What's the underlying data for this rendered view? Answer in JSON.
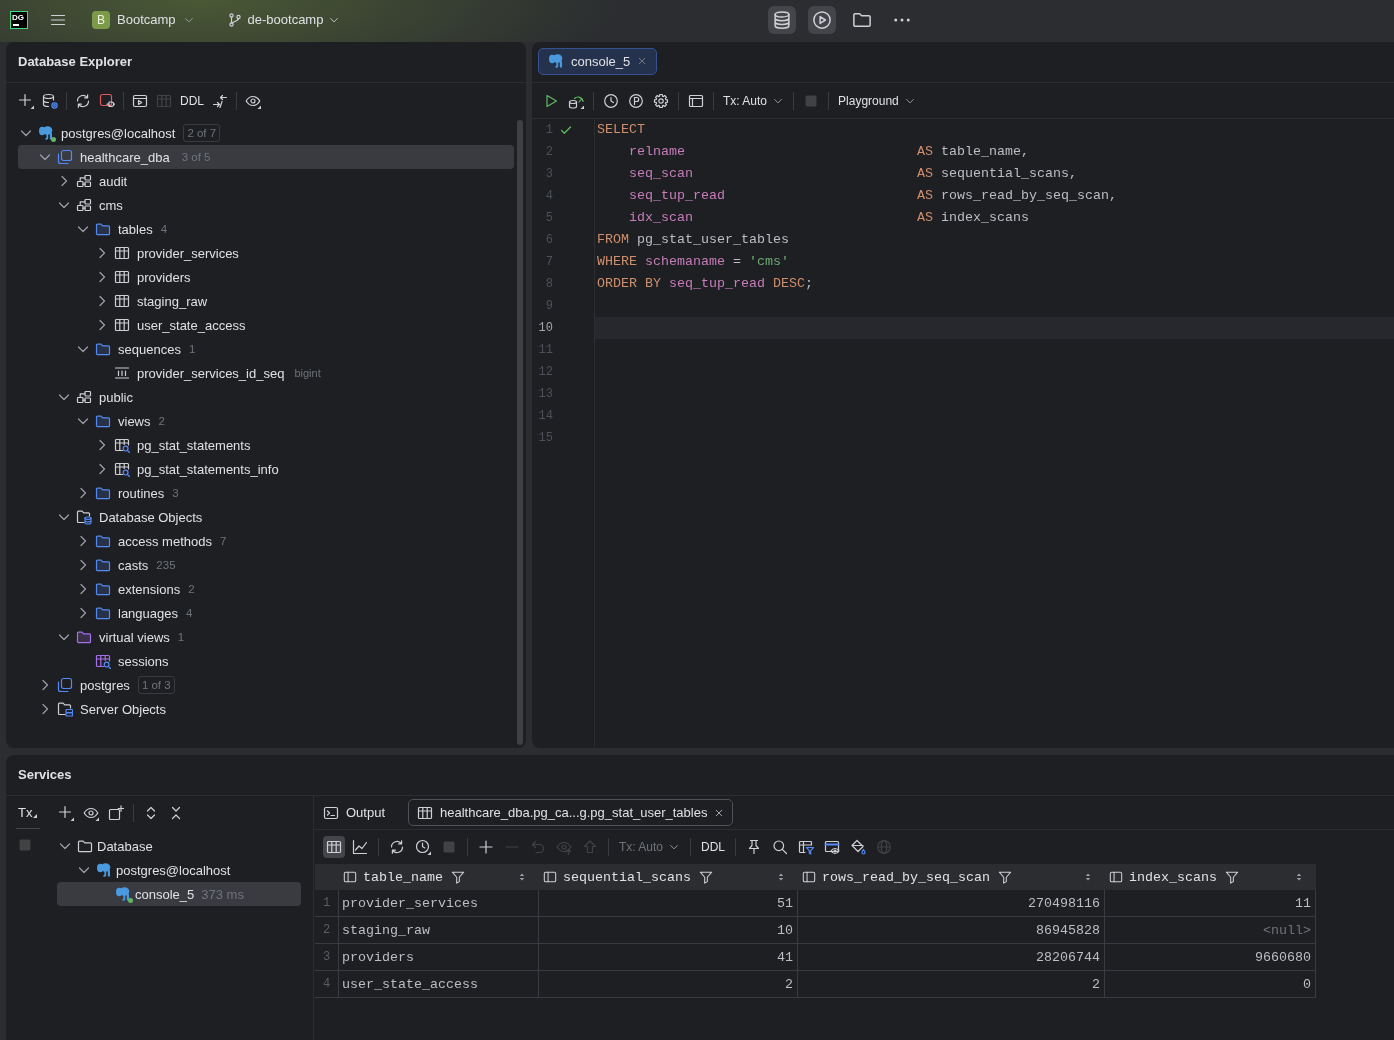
{
  "title_bar": {
    "logo": "DG",
    "project": {
      "initial": "B",
      "name": "Bootcamp"
    },
    "branch": "de-bootcamp",
    "tools": [
      {
        "kind": "database",
        "selected": true
      },
      {
        "kind": "services",
        "selected": true
      },
      {
        "kind": "project",
        "selected": false
      },
      {
        "kind": "more",
        "selected": false
      }
    ]
  },
  "database_explorer": {
    "title": "Database Explorer",
    "toolbar": [
      [
        {
          "kind": "add_menu",
          "disabled": false
        },
        {
          "kind": "data_source",
          "disabled": false
        }
      ],
      [
        {
          "kind": "refresh",
          "disabled": false
        },
        {
          "kind": "disconnect",
          "disabled": false
        }
      ],
      [
        {
          "kind": "console",
          "disabled": false
        },
        {
          "kind": "table",
          "disabled": true
        },
        {
          "kind": "ddl",
          "label": "DDL",
          "disabled": false
        },
        {
          "kind": "jump",
          "disabled": false
        }
      ],
      [
        {
          "kind": "view_options",
          "disabled": false
        }
      ]
    ],
    "tree": [
      {
        "kind": "connection",
        "label": "postgres@localhost",
        "badge": "2 of 7",
        "expanded": true,
        "selected": false,
        "connected": true,
        "children": [
          {
            "kind": "database",
            "label": "healthcare_dba",
            "badge": "3 of 5",
            "expanded": true,
            "selected": true,
            "children": [
              {
                "kind": "schema",
                "label": "audit",
                "expanded": false,
                "selected": false
              },
              {
                "kind": "schema",
                "label": "cms",
                "expanded": true,
                "selected": false,
                "children": [
                  {
                    "kind": "folder",
                    "label": "tables",
                    "count": "4",
                    "expanded": true,
                    "selected": false,
                    "children": [
                      {
                        "kind": "table",
                        "label": "provider_services",
                        "expanded": false,
                        "selected": false
                      },
                      {
                        "kind": "table",
                        "label": "providers",
                        "expanded": false,
                        "selected": false
                      },
                      {
                        "kind": "table",
                        "label": "staging_raw",
                        "expanded": false,
                        "selected": false
                      },
                      {
                        "kind": "table",
                        "label": "user_state_access",
                        "expanded": false,
                        "selected": false
                      }
                    ]
                  },
                  {
                    "kind": "folder",
                    "label": "sequences",
                    "count": "1",
                    "expanded": true,
                    "selected": false,
                    "children": [
                      {
                        "kind": "sequence",
                        "label": "provider_services_id_seq",
                        "detail": "bigint",
                        "selected": false
                      }
                    ]
                  }
                ]
              },
              {
                "kind": "schema",
                "label": "public",
                "expanded": true,
                "selected": false,
                "children": [
                  {
                    "kind": "folder",
                    "label": "views",
                    "count": "2",
                    "expanded": true,
                    "selected": false,
                    "children": [
                      {
                        "kind": "view",
                        "label": "pg_stat_statements",
                        "expanded": false,
                        "selected": false
                      },
                      {
                        "kind": "view",
                        "label": "pg_stat_statements_info",
                        "expanded": false,
                        "selected": false
                      }
                    ]
                  },
                  {
                    "kind": "folder",
                    "label": "routines",
                    "count": "3",
                    "expanded": false,
                    "selected": false
                  }
                ]
              },
              {
                "kind": "objects_folder",
                "label": "Database Objects",
                "expanded": true,
                "selected": false,
                "children": [
                  {
                    "kind": "folder",
                    "label": "access methods",
                    "count": "7",
                    "expanded": false,
                    "selected": false
                  },
                  {
                    "kind": "folder",
                    "label": "casts",
                    "count": "235",
                    "expanded": false,
                    "selected": false
                  },
                  {
                    "kind": "folder",
                    "label": "extensions",
                    "count": "2",
                    "expanded": false,
                    "selected": false
                  },
                  {
                    "kind": "folder",
                    "label": "languages",
                    "count": "4",
                    "expanded": false,
                    "selected": false
                  }
                ]
              },
              {
                "kind": "virtual_folder",
                "label": "virtual views",
                "count": "1",
                "expanded": true,
                "selected": false,
                "children": [
                  {
                    "kind": "virtual_view",
                    "label": "sessions",
                    "selected": false
                  }
                ]
              }
            ]
          },
          {
            "kind": "database",
            "label": "postgres",
            "badge": "1 of 3",
            "expanded": false,
            "selected": false
          },
          {
            "kind": "server_folder",
            "label": "Server Objects",
            "expanded": false,
            "selected": false
          }
        ]
      }
    ]
  },
  "editor": {
    "tabs": [
      {
        "label": "console_5",
        "selected": true
      }
    ],
    "toolbar": [
      [
        {
          "kind": "run",
          "disabled": false
        },
        {
          "kind": "run_config",
          "disabled": false
        }
      ],
      [
        {
          "kind": "history",
          "disabled": false
        },
        {
          "kind": "parameters",
          "disabled": false
        },
        {
          "kind": "settings",
          "disabled": false
        }
      ],
      [
        {
          "kind": "layout",
          "disabled": false
        }
      ],
      [
        {
          "kind": "tx_mode",
          "label": "Tx: Auto",
          "disabled": false
        }
      ],
      [
        {
          "kind": "stop",
          "disabled": true
        }
      ],
      [
        {
          "kind": "session_mode",
          "label": "Playground",
          "disabled": false
        }
      ]
    ],
    "lines": [
      {
        "number": "1",
        "executed": true,
        "current": false,
        "tokens": [
          {
            "text": "SELECT",
            "kind": "keyword"
          }
        ]
      },
      {
        "number": "2",
        "executed": false,
        "current": false,
        "tokens": [
          {
            "text": "    relname",
            "kind": "identifier"
          },
          {
            "text": "                             AS",
            "kind": "keyword"
          },
          {
            "text": " table_name,",
            "kind": "plain"
          }
        ]
      },
      {
        "number": "3",
        "executed": false,
        "current": false,
        "tokens": [
          {
            "text": "    seq_scan",
            "kind": "identifier"
          },
          {
            "text": "                            AS",
            "kind": "keyword"
          },
          {
            "text": " sequential_scans,",
            "kind": "plain"
          }
        ]
      },
      {
        "number": "4",
        "executed": false,
        "current": false,
        "tokens": [
          {
            "text": "    seq_tup_read",
            "kind": "identifier"
          },
          {
            "text": "                        AS",
            "kind": "keyword"
          },
          {
            "text": " rows_read_by_seq_scan,",
            "kind": "plain"
          }
        ]
      },
      {
        "number": "5",
        "executed": false,
        "current": false,
        "tokens": [
          {
            "text": "    idx_scan",
            "kind": "identifier"
          },
          {
            "text": "                            AS",
            "kind": "keyword"
          },
          {
            "text": " index_scans",
            "kind": "plain"
          }
        ]
      },
      {
        "number": "6",
        "executed": false,
        "current": false,
        "tokens": [
          {
            "text": "FROM",
            "kind": "keyword"
          },
          {
            "text": " pg_stat_user_tables",
            "kind": "plain"
          }
        ]
      },
      {
        "number": "7",
        "executed": false,
        "current": false,
        "tokens": [
          {
            "text": "WHERE",
            "kind": "keyword"
          },
          {
            "text": " schemaname",
            "kind": "identifier"
          },
          {
            "text": " = ",
            "kind": "plain"
          },
          {
            "text": "'cms'",
            "kind": "string"
          }
        ]
      },
      {
        "number": "8",
        "executed": false,
        "current": false,
        "tokens": [
          {
            "text": "ORDER BY",
            "kind": "keyword"
          },
          {
            "text": " seq_tup_read",
            "kind": "identifier"
          },
          {
            "text": " DESC",
            "kind": "keyword"
          },
          {
            "text": ";",
            "kind": "plain"
          }
        ]
      },
      {
        "number": "9",
        "executed": false,
        "current": false
      },
      {
        "number": "10",
        "executed": false,
        "current": true
      },
      {
        "number": "11",
        "executed": false,
        "current": false
      },
      {
        "number": "12",
        "executed": false,
        "current": false
      },
      {
        "number": "13",
        "executed": false,
        "current": false
      },
      {
        "number": "14",
        "executed": false,
        "current": false
      },
      {
        "number": "15",
        "executed": false,
        "current": false
      }
    ]
  },
  "services": {
    "title": "Services",
    "tx_column": {
      "label": "Tx",
      "items": [
        {
          "kind": "stop",
          "disabled": true
        }
      ]
    },
    "toolbar": [
      [
        {
          "kind": "add_menu",
          "disabled": false
        },
        {
          "kind": "view_options",
          "disabled": false
        },
        {
          "kind": "add_tab",
          "disabled": false
        }
      ],
      [
        {
          "kind": "expand",
          "disabled": false
        },
        {
          "kind": "collapse",
          "disabled": false
        }
      ]
    ],
    "tree": [
      {
        "kind": "plain_folder",
        "label": "Database",
        "expanded": true,
        "selected": false,
        "children": [
          {
            "kind": "connection",
            "label": "postgres@localhost",
            "expanded": true,
            "selected": false,
            "connected": false,
            "children": [
              {
                "kind": "connection",
                "label": "console_5",
                "detail": "373 ms",
                "selected": true,
                "connected": true
              }
            ]
          }
        ]
      }
    ],
    "tabs": [
      {
        "kind": "output",
        "label": "Output",
        "selected": false
      },
      {
        "kind": "result",
        "label": "healthcare_dba.pg_ca...g.pg_stat_user_tables",
        "selected": true
      }
    ],
    "result_toolbar": [
      [
        {
          "kind": "grid",
          "selected": true,
          "disabled": false
        },
        {
          "kind": "chart",
          "selected": false,
          "disabled": false
        }
      ],
      [
        {
          "kind": "refresh",
          "disabled": false
        },
        {
          "kind": "history_menu",
          "disabled": false
        },
        {
          "kind": "stop",
          "disabled": true
        }
      ],
      [
        {
          "kind": "add",
          "disabled": false
        },
        {
          "kind": "remove",
          "disabled": true
        },
        {
          "kind": "undo",
          "disabled": true
        },
        {
          "kind": "preview",
          "disabled": true
        },
        {
          "kind": "submit",
          "disabled": true
        }
      ],
      [
        {
          "kind": "tx_mode",
          "label": "Tx: Auto",
          "disabled": true
        }
      ],
      [
        {
          "kind": "ddl",
          "label": "DDL",
          "disabled": false
        }
      ],
      [
        {
          "kind": "pin",
          "disabled": false
        },
        {
          "kind": "search",
          "disabled": false
        },
        {
          "kind": "filter_table",
          "disabled": false
        },
        {
          "kind": "table_view",
          "disabled": false
        },
        {
          "kind": "paint",
          "disabled": false
        },
        {
          "kind": "globe",
          "disabled": true
        }
      ]
    ],
    "table": {
      "columns": [
        {
          "name": "table_name",
          "kind": "text"
        },
        {
          "name": "sequential_scans",
          "kind": "number"
        },
        {
          "name": "rows_read_by_seq_scan",
          "kind": "number"
        },
        {
          "name": "index_scans",
          "kind": "number"
        }
      ],
      "rows": [
        {
          "number": "1",
          "cells": [
            {
              "text": "provider_services",
              "kind": "value"
            },
            {
              "text": "51",
              "kind": "value"
            },
            {
              "text": "270498116",
              "kind": "value"
            },
            {
              "text": "11",
              "kind": "value"
            }
          ]
        },
        {
          "number": "2",
          "cells": [
            {
              "text": "staging_raw",
              "kind": "value"
            },
            {
              "text": "10",
              "kind": "value"
            },
            {
              "text": "86945828",
              "kind": "value"
            },
            {
              "text": "<null>",
              "kind": "null"
            }
          ]
        },
        {
          "number": "3",
          "cells": [
            {
              "text": "providers",
              "kind": "value"
            },
            {
              "text": "41",
              "kind": "value"
            },
            {
              "text": "28206744",
              "kind": "value"
            },
            {
              "text": "9660680",
              "kind": "value"
            }
          ]
        },
        {
          "number": "4",
          "cells": [
            {
              "text": "user_state_access",
              "kind": "value"
            },
            {
              "text": "2",
              "kind": "value"
            },
            {
              "text": "2",
              "kind": "value"
            },
            {
              "text": "0",
              "kind": "value"
            }
          ]
        }
      ]
    }
  }
}
